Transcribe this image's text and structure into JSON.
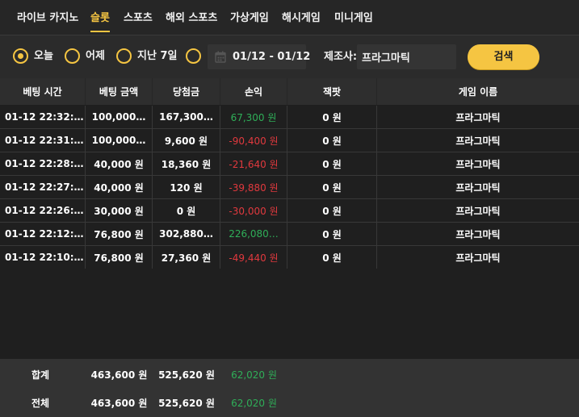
{
  "tabs": [
    {
      "label": "라이브 카지노",
      "active": false
    },
    {
      "label": "슬롯",
      "active": true
    },
    {
      "label": "스포츠",
      "active": false
    },
    {
      "label": "해외 스포츠",
      "active": false
    },
    {
      "label": "가상게임",
      "active": false
    },
    {
      "label": "해시게임",
      "active": false
    },
    {
      "label": "미니게임",
      "active": false
    }
  ],
  "filter": {
    "periods": [
      {
        "label": "오늘",
        "selected": true
      },
      {
        "label": "어제",
        "selected": false
      },
      {
        "label": "지난 7일",
        "selected": false
      },
      {
        "label": "",
        "selected": false
      }
    ],
    "date_range": "01/12 - 01/12",
    "date_icon": "calendar-icon",
    "maker_label": "제조사:",
    "maker_value": "프라그마틱",
    "search_label": "검색"
  },
  "table": {
    "headers": [
      "베팅 시간",
      "베팅 금액",
      "당첨금",
      "손익",
      "잭팟",
      "게임 이름"
    ],
    "rows": [
      {
        "time": "01-12 22:32:…",
        "bet": "100,000…",
        "win": "167,300…",
        "pnl": "67,300 원",
        "pnl_sign": "pos",
        "jackpot": "0 원",
        "game": "프라그마틱"
      },
      {
        "time": "01-12 22:31:…",
        "bet": "100,000…",
        "win": "9,600 원",
        "pnl": "-90,400 원",
        "pnl_sign": "neg",
        "jackpot": "0 원",
        "game": "프라그마틱"
      },
      {
        "time": "01-12 22:28:…",
        "bet": "40,000 원",
        "win": "18,360 원",
        "pnl": "-21,640 원",
        "pnl_sign": "neg",
        "jackpot": "0 원",
        "game": "프라그마틱"
      },
      {
        "time": "01-12 22:27:…",
        "bet": "40,000 원",
        "win": "120 원",
        "pnl": "-39,880 원",
        "pnl_sign": "neg",
        "jackpot": "0 원",
        "game": "프라그마틱"
      },
      {
        "time": "01-12 22:26:…",
        "bet": "30,000 원",
        "win": "0 원",
        "pnl": "-30,000 원",
        "pnl_sign": "neg",
        "jackpot": "0 원",
        "game": "프라그마틱"
      },
      {
        "time": "01-12 22:12:…",
        "bet": "76,800 원",
        "win": "302,880…",
        "pnl": "226,080…",
        "pnl_sign": "pos",
        "jackpot": "0 원",
        "game": "프라그마틱"
      },
      {
        "time": "01-12 22:10:…",
        "bet": "76,800 원",
        "win": "27,360 원",
        "pnl": "-49,440 원",
        "pnl_sign": "neg",
        "jackpot": "0 원",
        "game": "프라그마틱"
      }
    ]
  },
  "summary": {
    "subtotal": {
      "label": "합계",
      "bet": "463,600 원",
      "win": "525,620 원",
      "pnl": "62,020 원"
    },
    "total": {
      "label": "전체",
      "bet": "463,600 원",
      "win": "525,620 원",
      "pnl": "62,020 원"
    }
  },
  "colors": {
    "accent": "#f5c542",
    "positive": "#2fae58",
    "negative": "#e0393e"
  }
}
